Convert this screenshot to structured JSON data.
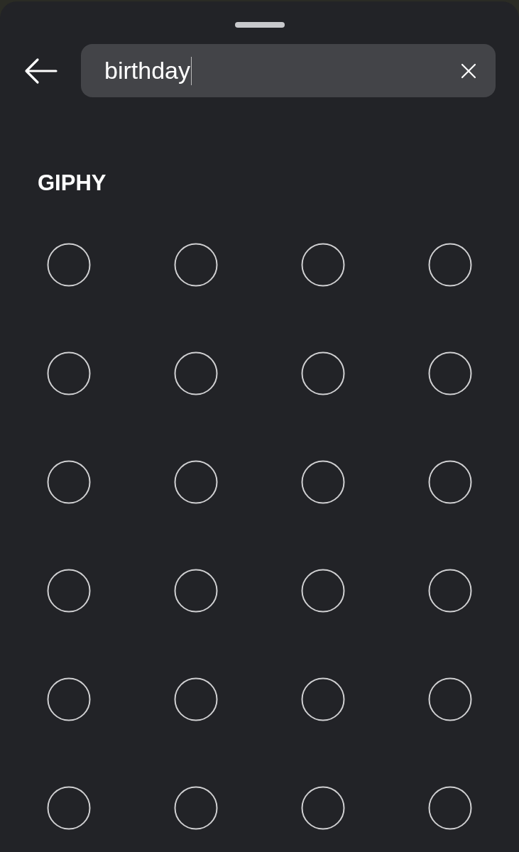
{
  "search": {
    "value": "birthday",
    "focused": true
  },
  "section": {
    "title": "GIPHY"
  },
  "results": [
    {
      "kind": "loading"
    },
    {
      "kind": "loading"
    },
    {
      "kind": "loading"
    },
    {
      "kind": "loading"
    },
    {
      "kind": "loading"
    },
    {
      "kind": "loading"
    },
    {
      "kind": "loading"
    },
    {
      "kind": "loading"
    },
    {
      "kind": "loading"
    },
    {
      "kind": "loading"
    },
    {
      "kind": "loading"
    },
    {
      "kind": "loading"
    },
    {
      "kind": "loading"
    },
    {
      "kind": "loading"
    },
    {
      "kind": "loading"
    },
    {
      "kind": "loading"
    },
    {
      "kind": "loading"
    },
    {
      "kind": "loading"
    },
    {
      "kind": "loading"
    },
    {
      "kind": "loading"
    },
    {
      "kind": "loading"
    },
    {
      "kind": "loading"
    },
    {
      "kind": "loading"
    },
    {
      "kind": "loading"
    }
  ]
}
